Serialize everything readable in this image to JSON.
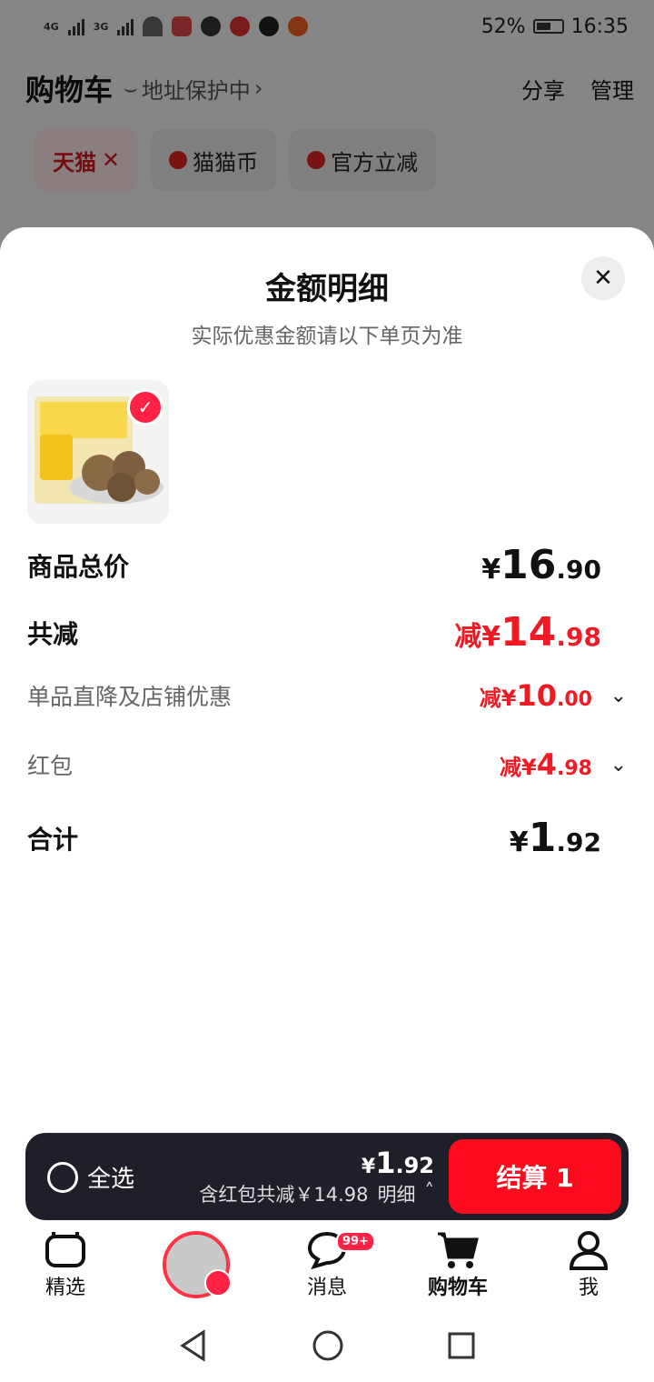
{
  "status": {
    "network1": "4G",
    "network2": "3G",
    "battery": "52%",
    "time": "16:35"
  },
  "cart": {
    "title": "购物车",
    "address": "地址保护中",
    "share": "分享",
    "manage": "管理",
    "filters": [
      {
        "label": "天猫",
        "active": true
      },
      {
        "label": "猫猫币",
        "active": false
      },
      {
        "label": "官方立减",
        "active": false
      }
    ]
  },
  "sheet": {
    "title": "金额明细",
    "subtitle": "实际优惠金额请以下单页为准",
    "rows": [
      {
        "label": "商品总价",
        "prefix": "",
        "currency": "¥",
        "int": "16",
        "dec": ".90"
      },
      {
        "label": "共减",
        "prefix": "减",
        "currency": "¥",
        "int": "14",
        "dec": ".98"
      },
      {
        "label": "单品直降及店铺优惠",
        "prefix": "减",
        "currency": "¥",
        "int": "10",
        "dec": ".00"
      },
      {
        "label": "红包",
        "prefix": "减",
        "currency": "¥",
        "int": "4",
        "dec": ".98"
      },
      {
        "label": "合计",
        "prefix": "",
        "currency": "¥",
        "int": "1",
        "dec": ".92"
      }
    ]
  },
  "checkout": {
    "select_all": "全选",
    "currency": "¥",
    "int": "1",
    "dec": ".92",
    "saving": "含红包共减￥14.98",
    "detail": "明细",
    "button": "结算 1"
  },
  "tabs": [
    {
      "label": "精选"
    },
    {
      "label": ""
    },
    {
      "label": "消息",
      "badge": "99+"
    },
    {
      "label": "购物车"
    },
    {
      "label": "我"
    }
  ],
  "colors": {
    "accent_red": "#ee1b24",
    "dark_bar": "#1e1f29",
    "checkout_red": "#ff0a1c"
  }
}
